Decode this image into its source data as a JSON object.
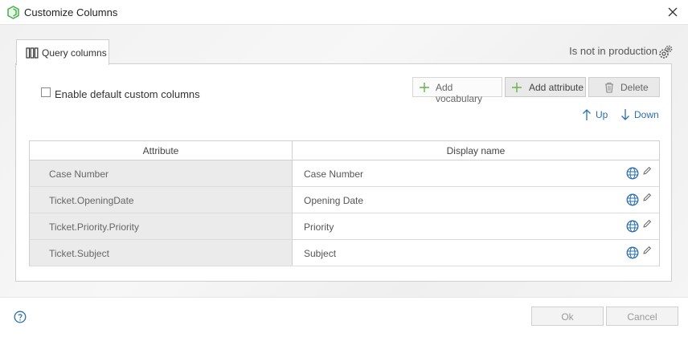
{
  "window": {
    "title": "Customize Columns"
  },
  "tab": {
    "label": "Query columns"
  },
  "status": {
    "production": "Is not in production"
  },
  "options": {
    "enable_default_label": "Enable default custom columns"
  },
  "toolbar": {
    "add_vocabulary": "Add vocabulary",
    "add_attribute": "Add attribute",
    "delete": "Delete",
    "up": "Up",
    "down": "Down"
  },
  "grid": {
    "headers": {
      "attribute": "Attribute",
      "display_name": "Display name"
    },
    "rows": [
      {
        "attribute": "Case Number",
        "display_name": "Case Number"
      },
      {
        "attribute": "Ticket.OpeningDate",
        "display_name": "Opening Date"
      },
      {
        "attribute": "Ticket.Priority.Priority",
        "display_name": "Priority"
      },
      {
        "attribute": "Ticket.Subject",
        "display_name": "Subject"
      }
    ]
  },
  "footer": {
    "ok": "Ok",
    "cancel": "Cancel"
  },
  "colors": {
    "accent": "#2b6fad",
    "add_green": "#6ab04c",
    "app_icon_green": "#4caf50"
  },
  "icons": [
    "app-icon",
    "close-icon",
    "columns-icon",
    "gear-icon",
    "plus-icon",
    "trash-icon",
    "arrow-up-icon",
    "arrow-down-icon",
    "globe-icon",
    "pencil-icon",
    "help-icon"
  ]
}
